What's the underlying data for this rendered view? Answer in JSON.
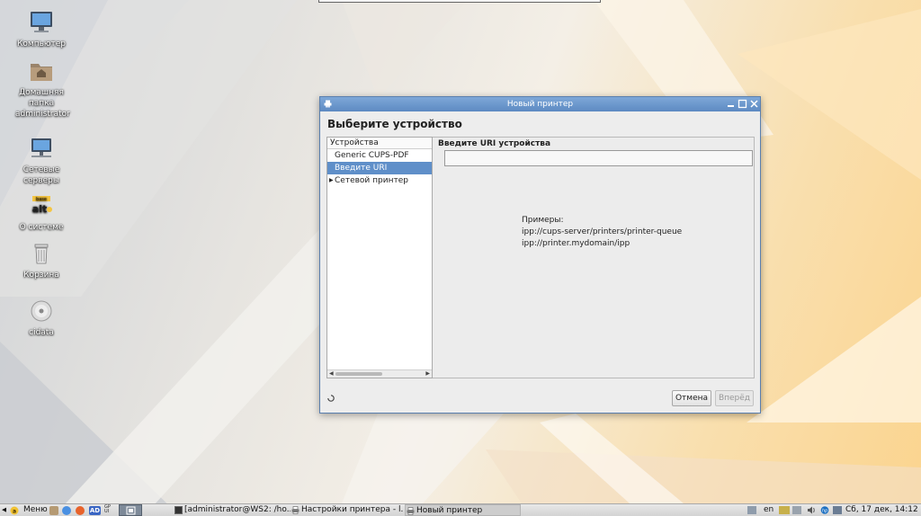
{
  "desktop": {
    "icons": [
      {
        "label": "Компьютер"
      },
      {
        "label": "Домашняя папка administrator"
      },
      {
        "label": "Сетевые серверы"
      },
      {
        "label": "О системе"
      },
      {
        "label": "Корзина"
      },
      {
        "label": "cidata"
      }
    ]
  },
  "dialog": {
    "title": "Новый принтер",
    "heading": "Выберите устройство",
    "device_list": {
      "header": "Устройства",
      "items": [
        {
          "label": "Generic CUPS-PDF"
        },
        {
          "label": "Введите URI",
          "selected": true
        },
        {
          "label": "Сетевой принтер",
          "expandable": true
        }
      ]
    },
    "uri": {
      "label": "Введите URI устройства",
      "value": "",
      "examples": [
        "Примеры:",
        "ipp://cups-server/printers/printer-queue",
        "ipp://printer.mydomain/ipp"
      ]
    },
    "buttons": {
      "cancel": "Отмена",
      "next": "Вперёд"
    }
  },
  "taskbar": {
    "menu_label": "Меню",
    "quick_launch": [
      {
        "icon": "file-manager-icon"
      },
      {
        "icon": "browser-icon"
      },
      {
        "icon": "firefox-icon"
      },
      {
        "icon": "ad-icon",
        "label": "AD"
      },
      {
        "icon": "gpui-icon",
        "label": "GP UI"
      }
    ],
    "tasks": [
      {
        "label": "[administrator@WS2: /ho..."
      },
      {
        "label": "Настройки принтера - l..."
      },
      {
        "label": "Новый принтер"
      }
    ],
    "tray": {
      "keyboard_layout": "en",
      "clock": "Сб, 17 дек, 14:12"
    }
  }
}
